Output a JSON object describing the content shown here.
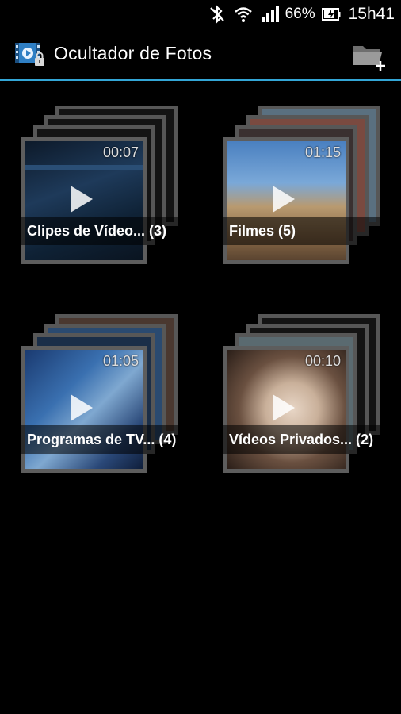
{
  "status_bar": {
    "battery": "66%",
    "time": "15h41"
  },
  "icons": {
    "bluetooth": "bluetooth-off-icon",
    "wifi": "wifi-icon",
    "signal": "signal-icon",
    "battery": "battery-charging-icon",
    "app": "video-lock-icon",
    "add_folder": "add-folder-icon",
    "play": "play-icon"
  },
  "colors": {
    "accent": "#33a6d6",
    "background": "#000000"
  },
  "action_bar": {
    "title": "Ocultador de Fotos"
  },
  "albums": [
    {
      "label": "Clipes de Vídeo... (3)",
      "duration": "00:07"
    },
    {
      "label": "Filmes (5)",
      "duration": "01:15"
    },
    {
      "label": "Programas de TV... (4)",
      "duration": "01:05"
    },
    {
      "label": "Vídeos Privados... (2)",
      "duration": "00:10"
    }
  ]
}
